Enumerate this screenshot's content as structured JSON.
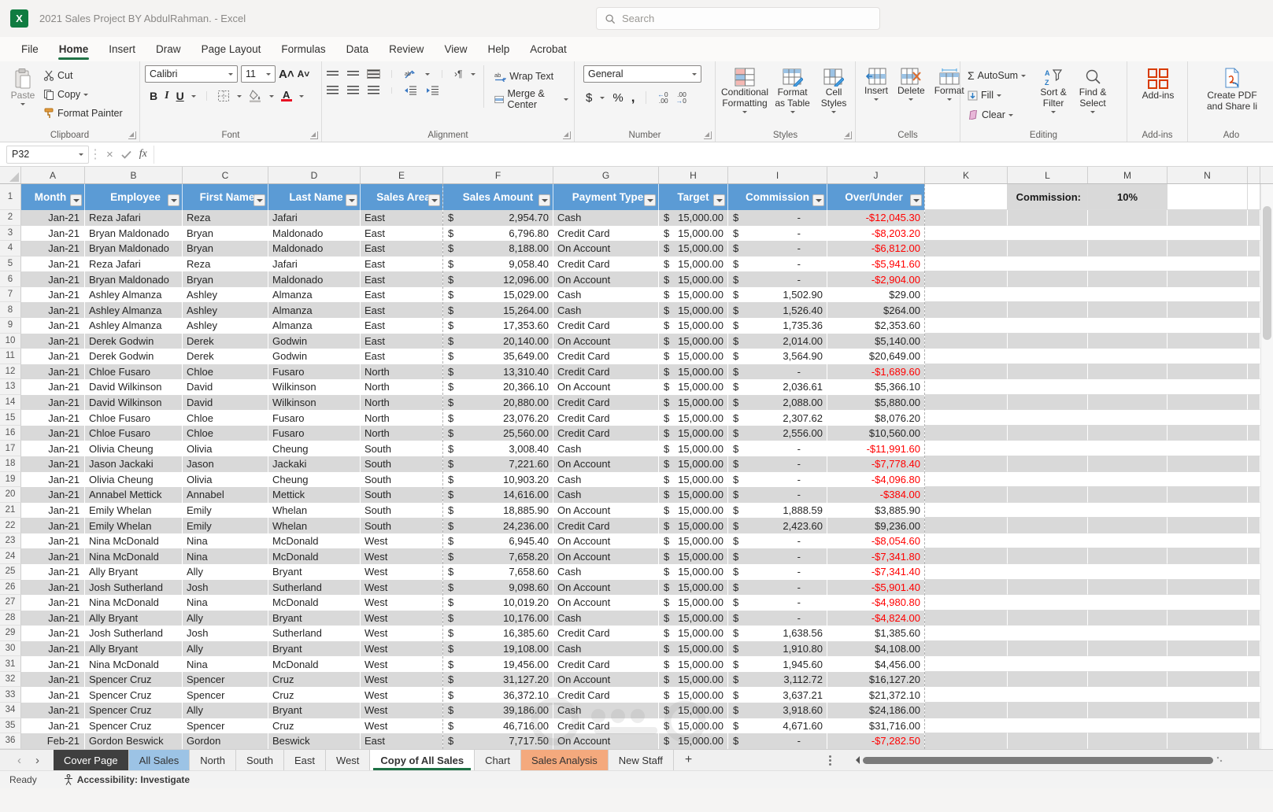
{
  "title_bar": {
    "title": "2021 Sales Project BY AbdulRahman.  -  Excel",
    "search_placeholder": "Search"
  },
  "menu": {
    "tabs": [
      {
        "label": "File",
        "active": false
      },
      {
        "label": "Home",
        "active": true
      },
      {
        "label": "Insert",
        "active": false
      },
      {
        "label": "Draw",
        "active": false
      },
      {
        "label": "Page Layout",
        "active": false
      },
      {
        "label": "Formulas",
        "active": false
      },
      {
        "label": "Data",
        "active": false
      },
      {
        "label": "Review",
        "active": false
      },
      {
        "label": "View",
        "active": false
      },
      {
        "label": "Help",
        "active": false
      },
      {
        "label": "Acrobat",
        "active": false
      }
    ]
  },
  "ribbon": {
    "clipboard": {
      "paste": "Paste",
      "cut": "Cut",
      "copy": "Copy",
      "format_painter": "Format Painter",
      "label": "Clipboard"
    },
    "font": {
      "font_name": "Calibri",
      "font_size": "11",
      "bold": "B",
      "italic": "I",
      "underline": "U",
      "label": "Font"
    },
    "alignment": {
      "wrap_text": "Wrap Text",
      "merge_center": "Merge & Center",
      "label": "Alignment"
    },
    "number": {
      "format": "General",
      "label": "Number"
    },
    "styles": {
      "conditional": "Conditional Formatting",
      "format_table": "Format as Table",
      "cell_styles": "Cell Styles",
      "label": "Styles"
    },
    "cells": {
      "insert": "Insert",
      "delete": "Delete",
      "format": "Format",
      "label": "Cells"
    },
    "editing": {
      "autosum": "AutoSum",
      "fill": "Fill",
      "clear": "Clear",
      "sort": "Sort & Filter",
      "find": "Find & Select",
      "label": "Editing"
    },
    "addins": {
      "button": "Add-ins",
      "label": "Add-ins"
    },
    "acrobat": {
      "button": "Create PDF and Share li",
      "label": "Ado"
    }
  },
  "formula_bar": {
    "name_box": "P32",
    "formula": ""
  },
  "grid": {
    "column_letters": [
      "A",
      "B",
      "C",
      "D",
      "E",
      "F",
      "G",
      "H",
      "I",
      "J",
      "K",
      "L",
      "M",
      "N"
    ],
    "headers": [
      "Month",
      "Employee",
      "First Name",
      "Last Name",
      "Sales Area",
      "Sales Amount",
      "Payment Type",
      "Target",
      "Commission",
      "Over/Under"
    ],
    "commission_label": "Commission:",
    "commission_value": "10%",
    "header_color": "#5b9bd5",
    "band_color": "#d9d9d9",
    "negative_color": "#ff0000",
    "rows": [
      [
        "Jan-21",
        "Reza Jafari",
        "Reza",
        "Jafari",
        "East",
        "2,954.70",
        "Cash",
        "15,000.00",
        "-",
        "-$12,045.30"
      ],
      [
        "Jan-21",
        "Bryan Maldonado",
        "Bryan",
        "Maldonado",
        "East",
        "6,796.80",
        "Credit Card",
        "15,000.00",
        "-",
        "-$8,203.20"
      ],
      [
        "Jan-21",
        "Bryan Maldonado",
        "Bryan",
        "Maldonado",
        "East",
        "8,188.00",
        "On Account",
        "15,000.00",
        "-",
        "-$6,812.00"
      ],
      [
        "Jan-21",
        "Reza Jafari",
        "Reza",
        "Jafari",
        "East",
        "9,058.40",
        "Credit Card",
        "15,000.00",
        "-",
        "-$5,941.60"
      ],
      [
        "Jan-21",
        "Bryan Maldonado",
        "Bryan",
        "Maldonado",
        "East",
        "12,096.00",
        "On Account",
        "15,000.00",
        "-",
        "-$2,904.00"
      ],
      [
        "Jan-21",
        "Ashley Almanza",
        "Ashley",
        "Almanza",
        "East",
        "15,029.00",
        "Cash",
        "15,000.00",
        "1,502.90",
        "$29.00"
      ],
      [
        "Jan-21",
        "Ashley Almanza",
        "Ashley",
        "Almanza",
        "East",
        "15,264.00",
        "Cash",
        "15,000.00",
        "1,526.40",
        "$264.00"
      ],
      [
        "Jan-21",
        "Ashley Almanza",
        "Ashley",
        "Almanza",
        "East",
        "17,353.60",
        "Credit Card",
        "15,000.00",
        "1,735.36",
        "$2,353.60"
      ],
      [
        "Jan-21",
        "Derek Godwin",
        "Derek",
        "Godwin",
        "East",
        "20,140.00",
        "On Account",
        "15,000.00",
        "2,014.00",
        "$5,140.00"
      ],
      [
        "Jan-21",
        "Derek Godwin",
        "Derek",
        "Godwin",
        "East",
        "35,649.00",
        "Credit Card",
        "15,000.00",
        "3,564.90",
        "$20,649.00"
      ],
      [
        "Jan-21",
        "Chloe Fusaro",
        "Chloe",
        "Fusaro",
        "North",
        "13,310.40",
        "Credit Card",
        "15,000.00",
        "-",
        "-$1,689.60"
      ],
      [
        "Jan-21",
        "David Wilkinson",
        "David",
        "Wilkinson",
        "North",
        "20,366.10",
        "On Account",
        "15,000.00",
        "2,036.61",
        "$5,366.10"
      ],
      [
        "Jan-21",
        "David Wilkinson",
        "David",
        "Wilkinson",
        "North",
        "20,880.00",
        "Credit Card",
        "15,000.00",
        "2,088.00",
        "$5,880.00"
      ],
      [
        "Jan-21",
        "Chloe Fusaro",
        "Chloe",
        "Fusaro",
        "North",
        "23,076.20",
        "Credit Card",
        "15,000.00",
        "2,307.62",
        "$8,076.20"
      ],
      [
        "Jan-21",
        "Chloe Fusaro",
        "Chloe",
        "Fusaro",
        "North",
        "25,560.00",
        "Credit Card",
        "15,000.00",
        "2,556.00",
        "$10,560.00"
      ],
      [
        "Jan-21",
        "Olivia Cheung",
        "Olivia",
        "Cheung",
        "South",
        "3,008.40",
        "Cash",
        "15,000.00",
        "-",
        "-$11,991.60"
      ],
      [
        "Jan-21",
        "Jason Jackaki",
        "Jason",
        "Jackaki",
        "South",
        "7,221.60",
        "On Account",
        "15,000.00",
        "-",
        "-$7,778.40"
      ],
      [
        "Jan-21",
        "Olivia Cheung",
        "Olivia",
        "Cheung",
        "South",
        "10,903.20",
        "Cash",
        "15,000.00",
        "-",
        "-$4,096.80"
      ],
      [
        "Jan-21",
        "Annabel Mettick",
        "Annabel",
        "Mettick",
        "South",
        "14,616.00",
        "Cash",
        "15,000.00",
        "-",
        "-$384.00"
      ],
      [
        "Jan-21",
        "Emily Whelan",
        "Emily",
        "Whelan",
        "South",
        "18,885.90",
        "On Account",
        "15,000.00",
        "1,888.59",
        "$3,885.90"
      ],
      [
        "Jan-21",
        "Emily Whelan",
        "Emily",
        "Whelan",
        "South",
        "24,236.00",
        "Credit Card",
        "15,000.00",
        "2,423.60",
        "$9,236.00"
      ],
      [
        "Jan-21",
        "Nina McDonald",
        "Nina",
        "McDonald",
        "West",
        "6,945.40",
        "On Account",
        "15,000.00",
        "-",
        "-$8,054.60"
      ],
      [
        "Jan-21",
        "Nina McDonald",
        "Nina",
        "McDonald",
        "West",
        "7,658.20",
        "On Account",
        "15,000.00",
        "-",
        "-$7,341.80"
      ],
      [
        "Jan-21",
        "Ally Bryant",
        "Ally",
        "Bryant",
        "West",
        "7,658.60",
        "Cash",
        "15,000.00",
        "-",
        "-$7,341.40"
      ],
      [
        "Jan-21",
        "Josh Sutherland",
        "Josh",
        "Sutherland",
        "West",
        "9,098.60",
        "On Account",
        "15,000.00",
        "-",
        "-$5,901.40"
      ],
      [
        "Jan-21",
        "Nina McDonald",
        "Nina",
        "McDonald",
        "West",
        "10,019.20",
        "On Account",
        "15,000.00",
        "-",
        "-$4,980.80"
      ],
      [
        "Jan-21",
        "Ally Bryant",
        "Ally",
        "Bryant",
        "West",
        "10,176.00",
        "Cash",
        "15,000.00",
        "-",
        "-$4,824.00"
      ],
      [
        "Jan-21",
        "Josh Sutherland",
        "Josh",
        "Sutherland",
        "West",
        "16,385.60",
        "Credit Card",
        "15,000.00",
        "1,638.56",
        "$1,385.60"
      ],
      [
        "Jan-21",
        "Ally Bryant",
        "Ally",
        "Bryant",
        "West",
        "19,108.00",
        "Cash",
        "15,000.00",
        "1,910.80",
        "$4,108.00"
      ],
      [
        "Jan-21",
        "Nina McDonald",
        "Nina",
        "McDonald",
        "West",
        "19,456.00",
        "Credit Card",
        "15,000.00",
        "1,945.60",
        "$4,456.00"
      ],
      [
        "Jan-21",
        "Spencer Cruz",
        "Spencer",
        "Cruz",
        "West",
        "31,127.20",
        "On Account",
        "15,000.00",
        "3,112.72",
        "$16,127.20"
      ],
      [
        "Jan-21",
        "Spencer Cruz",
        "Spencer",
        "Cruz",
        "West",
        "36,372.10",
        "Credit Card",
        "15,000.00",
        "3,637.21",
        "$21,372.10"
      ],
      [
        "Jan-21",
        "Spencer Cruz",
        "Ally",
        "Bryant",
        "West",
        "39,186.00",
        "Cash",
        "15,000.00",
        "3,918.60",
        "$24,186.00"
      ],
      [
        "Jan-21",
        "Spencer Cruz",
        "Spencer",
        "Cruz",
        "West",
        "46,716.00",
        "Credit Card",
        "15,000.00",
        "4,671.60",
        "$31,716.00"
      ],
      [
        "Feb-21",
        "Gordon Beswick",
        "Gordon",
        "Beswick",
        "East",
        "7,717.50",
        "On Account",
        "15,000.00",
        "-",
        "-$7,282.50"
      ]
    ]
  },
  "sheet_tabs": [
    {
      "label": "Cover Page",
      "style": "dark"
    },
    {
      "label": "All Sales",
      "style": "blue"
    },
    {
      "label": "North",
      "style": ""
    },
    {
      "label": "South",
      "style": ""
    },
    {
      "label": "East",
      "style": ""
    },
    {
      "label": "West",
      "style": ""
    },
    {
      "label": "Copy of All Sales",
      "style": "active"
    },
    {
      "label": "Chart",
      "style": ""
    },
    {
      "label": "Sales Analysis",
      "style": "orange"
    },
    {
      "label": "New Staff",
      "style": ""
    }
  ],
  "status_bar": {
    "mode": "Ready",
    "accessibility": "Accessibility: Investigate"
  }
}
